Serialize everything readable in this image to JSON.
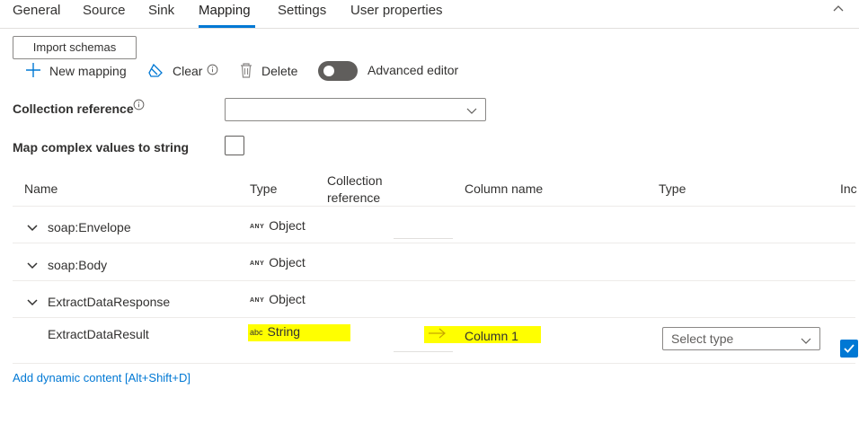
{
  "tabs": [
    {
      "label": "General"
    },
    {
      "label": "Source"
    },
    {
      "label": "Sink"
    },
    {
      "label": "Mapping"
    },
    {
      "label": "Settings"
    },
    {
      "label": "User properties"
    }
  ],
  "active_tab": "Mapping",
  "toolbar": {
    "import_label": "Import schemas",
    "new_mapping_label": "New mapping",
    "clear_label": "Clear",
    "delete_label": "Delete",
    "advanced_editor_label": "Advanced editor",
    "advanced_editor_on": false
  },
  "form": {
    "collection_reference_label": "Collection reference",
    "collection_reference_value": "",
    "map_complex_label": "Map complex values to string",
    "map_complex_checked": false
  },
  "table": {
    "headers": {
      "name": "Name",
      "type": "Type",
      "collection_ref_line1": "Collection",
      "collection_ref_line2": "reference",
      "column_name": "Column name",
      "sink_type": "Type",
      "inc": "Inc"
    },
    "rows": [
      {
        "name": "soap:Envelope",
        "type_tag": "ANY",
        "type": "Object"
      },
      {
        "name": "soap:Body",
        "type_tag": "ANY",
        "type": "Object"
      },
      {
        "name": "ExtractDataResponse",
        "type_tag": "ANY",
        "type": "Object"
      },
      {
        "name": "ExtractDataResult",
        "type_tag": "abc",
        "type": "String",
        "column_name": "Column 1",
        "sink_type_placeholder": "Select type",
        "included": true
      }
    ]
  },
  "footer": {
    "dynamic_content_link": "Add dynamic content [Alt+Shift+D]"
  },
  "colors": {
    "accent": "#0078d4",
    "highlight": "#ffff00",
    "toggle_off": "#605e5c"
  },
  "icons": [
    "plus-icon",
    "eraser-icon",
    "info-icon",
    "trash-icon",
    "chevron-down-icon",
    "chevron-up-icon",
    "arrow-right-icon",
    "checkmark-icon"
  ]
}
